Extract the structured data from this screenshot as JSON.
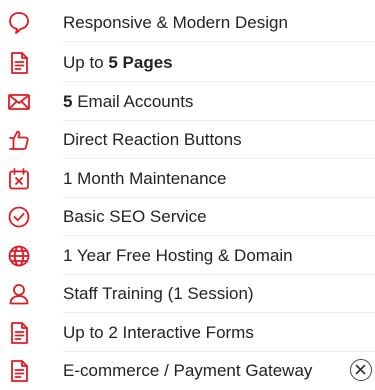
{
  "accent_color": "#e01b22",
  "features": [
    {
      "icon": "chat-bubble-icon",
      "prefix": "Responsive & Modern Design",
      "bold": "",
      "suffix": ""
    },
    {
      "icon": "document-icon",
      "prefix": "Up to ",
      "bold": "5 Pages",
      "suffix": ""
    },
    {
      "icon": "envelope-icon",
      "prefix": "",
      "bold": "5",
      "suffix": " Email Accounts"
    },
    {
      "icon": "thumbs-up-icon",
      "prefix": "Direct Reaction Buttons",
      "bold": "",
      "suffix": ""
    },
    {
      "icon": "calendar-icon",
      "prefix": "1 Month Maintenance",
      "bold": "",
      "suffix": ""
    },
    {
      "icon": "check-circle-icon",
      "prefix": "Basic SEO Service",
      "bold": "",
      "suffix": ""
    },
    {
      "icon": "globe-icon",
      "prefix": "1 Year Free Hosting & Domain",
      "bold": "",
      "suffix": ""
    },
    {
      "icon": "person-icon",
      "prefix": "Staff Training (1 Session)",
      "bold": "",
      "suffix": ""
    },
    {
      "icon": "form-icon",
      "prefix": "Up to 2 Interactive Forms",
      "bold": "",
      "suffix": ""
    },
    {
      "icon": "cart-document-icon",
      "prefix": "E-commerce / Payment Gateway",
      "bold": "",
      "suffix": ""
    }
  ],
  "not_included_marker": "close-circle-icon"
}
